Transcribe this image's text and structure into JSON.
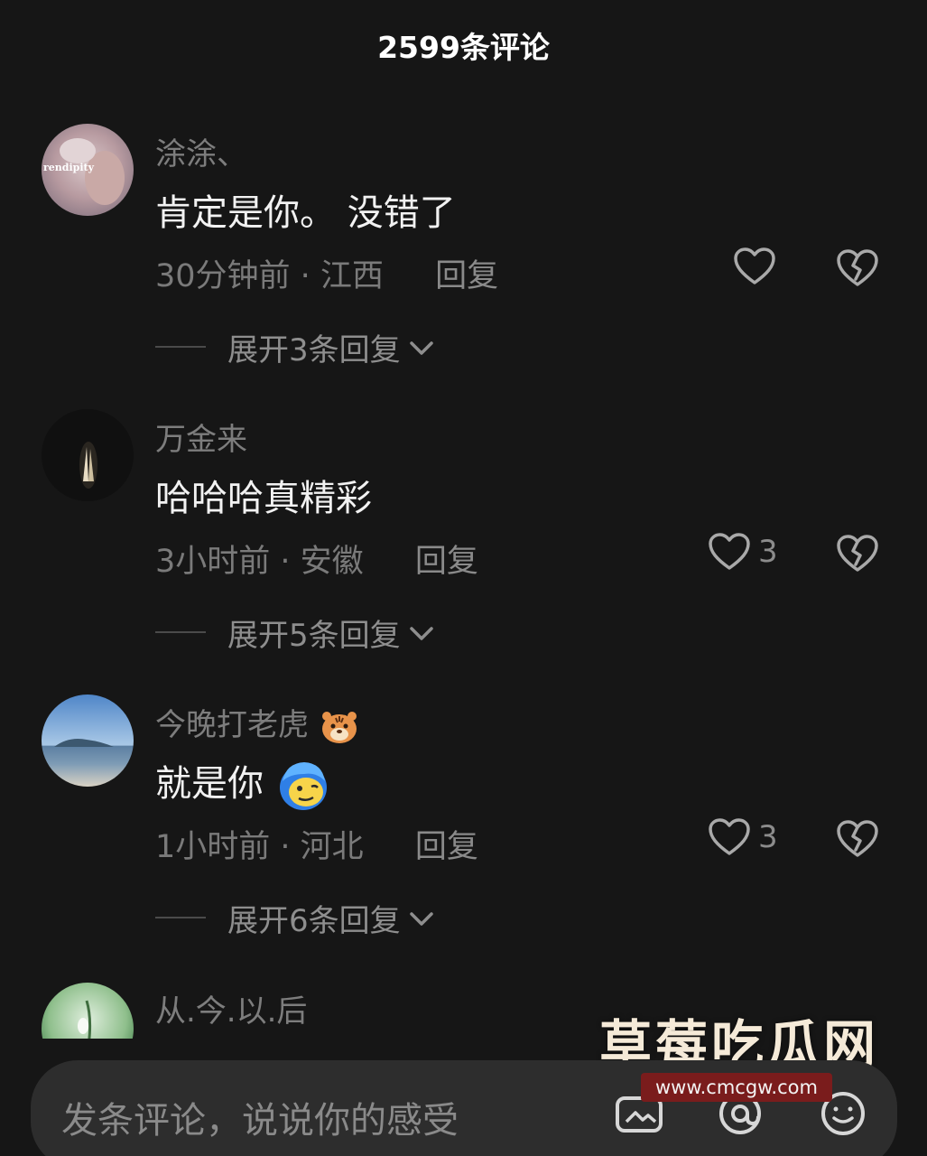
{
  "header": {
    "title": "2599条评论"
  },
  "comments": [
    {
      "username": "涂涂、",
      "text": "肯定是你。 没错了",
      "time": "30分钟前",
      "location": "江西",
      "reply": "回复",
      "likes": "",
      "expand": "展开3条回复",
      "avatar_text": "rendipity"
    },
    {
      "username": "万金来",
      "text": "哈哈哈真精彩",
      "time": "3小时前",
      "location": "安徽",
      "reply": "回复",
      "likes": "3",
      "expand": "展开5条回复"
    },
    {
      "username": "今晚打老虎",
      "text": "就是你",
      "time": "1小时前",
      "location": "河北",
      "reply": "回复",
      "likes": "3",
      "expand": "展开6条回复"
    },
    {
      "username": "从.今.以.后"
    }
  ],
  "meta_separator": " · ",
  "watermark": {
    "title": "草莓吃瓜网",
    "url": "www.cmcgw.com"
  },
  "input": {
    "placeholder": "发条评论，说说你的感受"
  },
  "icons": {
    "like": "heart-icon",
    "dislike": "broken-heart-icon",
    "expand": "chevron-down-icon",
    "image": "image-icon",
    "at": "at-mention-icon",
    "emoji": "emoji-icon"
  },
  "colors": {
    "background": "#161616",
    "secondary_text": "#7a7a7a",
    "input_bg": "#2d2d2d"
  }
}
